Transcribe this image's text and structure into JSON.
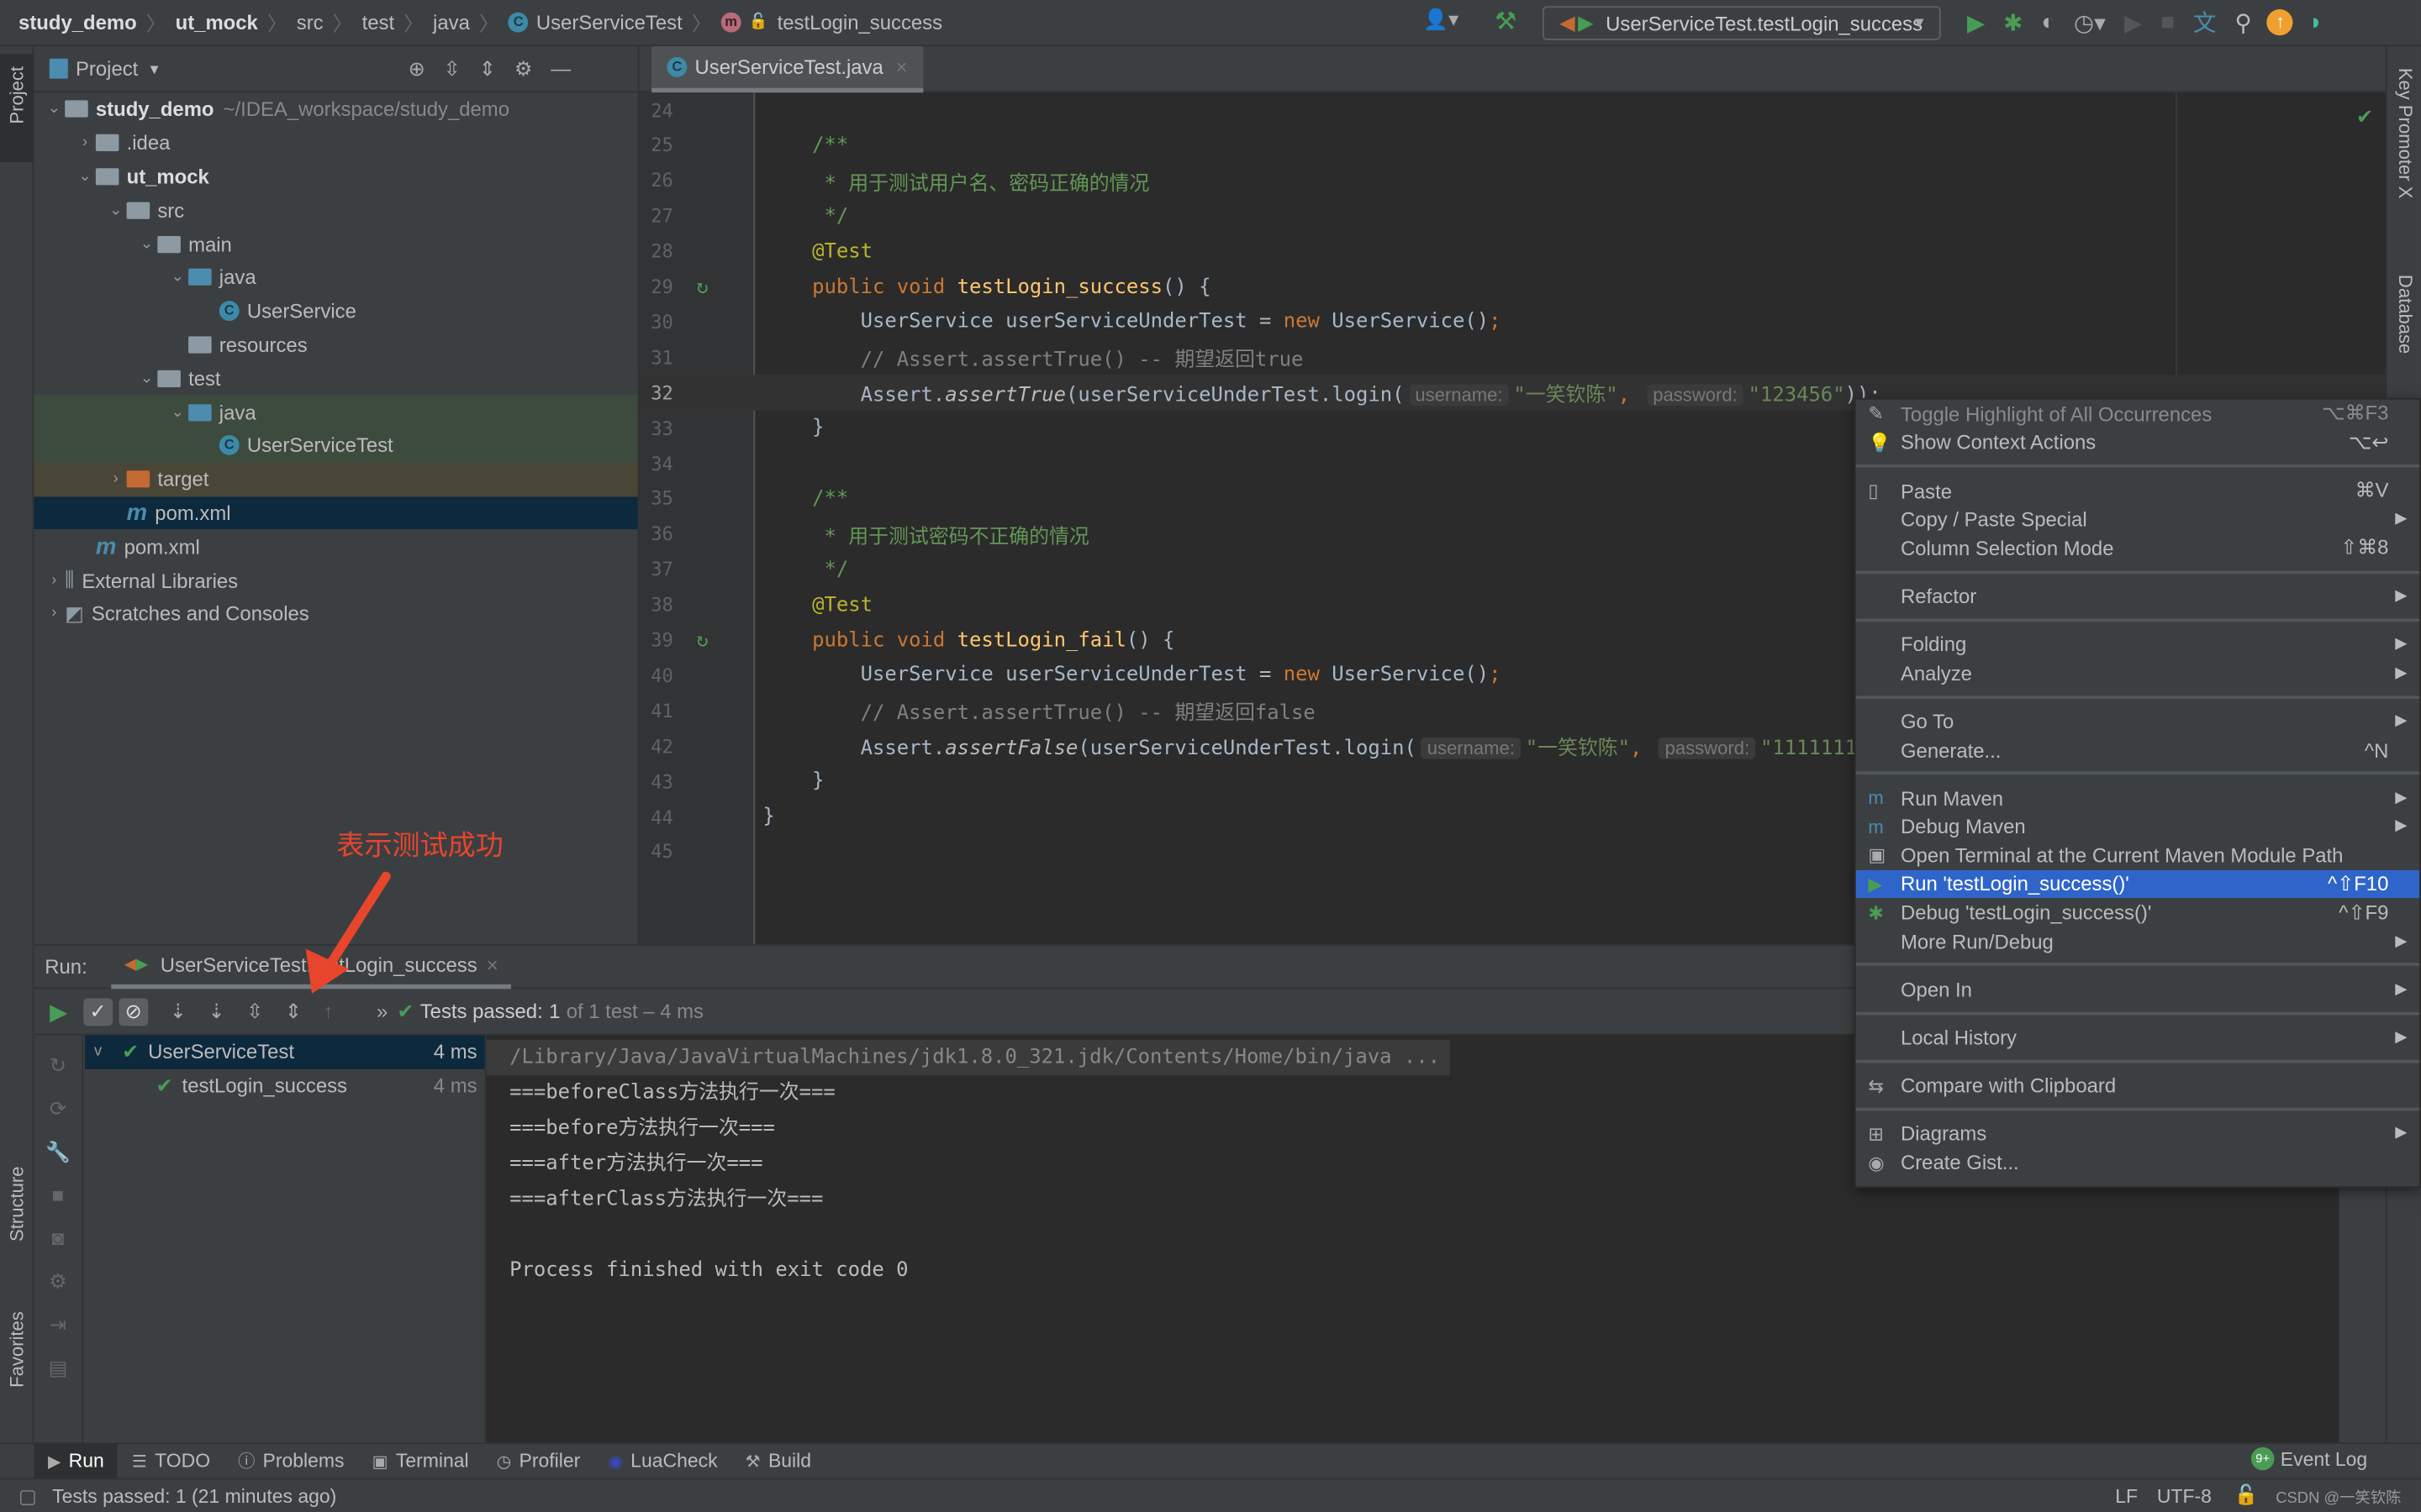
{
  "nav": {
    "breadcrumbs": [
      "study_demo",
      "ut_mock",
      "src",
      "test",
      "java",
      "UserServiceTest",
      "testLogin_success"
    ],
    "run_config": "UserServiceTest.testLogin_success"
  },
  "toolbar_icons": [
    "user-icon",
    "build-hammer-icon",
    "run-icon",
    "debug-icon",
    "coverage-icon",
    "profile-icon",
    "stop-icon",
    "translate-icon",
    "search-icon",
    "update-icon",
    "toolbox-icon"
  ],
  "left_strip": {
    "project": "Project",
    "structure": "Structure",
    "favorites": "Favorites"
  },
  "right_strip": {
    "key_promoter": "Key Promoter X",
    "database": "Database"
  },
  "project": {
    "title": "Project",
    "tree": [
      {
        "label": "study_demo",
        "extra": "~/IDEA_workspace/study_demo",
        "depth": 0,
        "arrow": "v",
        "icon": "folder",
        "bold": true
      },
      {
        "label": ".idea",
        "depth": 1,
        "arrow": ">",
        "icon": "folder"
      },
      {
        "label": "ut_mock",
        "depth": 1,
        "arrow": "v",
        "icon": "folder",
        "bold": true
      },
      {
        "label": "src",
        "depth": 2,
        "arrow": "v",
        "icon": "folder"
      },
      {
        "label": "main",
        "depth": 3,
        "arrow": "v",
        "icon": "folder"
      },
      {
        "label": "java",
        "depth": 4,
        "arrow": "v",
        "icon": "folder-blue"
      },
      {
        "label": "UserService",
        "depth": 5,
        "arrow": "",
        "icon": "class"
      },
      {
        "label": "resources",
        "depth": 4,
        "arrow": "",
        "icon": "folder"
      },
      {
        "label": "test",
        "depth": 3,
        "arrow": "v",
        "icon": "folder"
      },
      {
        "label": "java",
        "depth": 4,
        "arrow": "v",
        "icon": "folder-green",
        "hl": "green"
      },
      {
        "label": "UserServiceTest",
        "depth": 5,
        "arrow": "",
        "icon": "class",
        "hl": "green"
      },
      {
        "label": "target",
        "depth": 2,
        "arrow": ">",
        "icon": "folder-orange",
        "hl": "brown"
      },
      {
        "label": "pom.xml",
        "depth": 2,
        "arrow": "",
        "icon": "maven",
        "hl": "sel"
      },
      {
        "label": "pom.xml",
        "depth": 1,
        "arrow": "",
        "icon": "maven"
      },
      {
        "label": "External Libraries",
        "depth": 0,
        "arrow": ">",
        "icon": "library"
      },
      {
        "label": "Scratches and Consoles",
        "depth": 0,
        "arrow": ">",
        "icon": "scratch"
      }
    ]
  },
  "editor": {
    "tab": "UserServiceTest.java",
    "current_line": 32,
    "lines": [
      {
        "n": 24,
        "seg": []
      },
      {
        "n": 25,
        "seg": [
          [
            "d",
            "/**"
          ]
        ]
      },
      {
        "n": 26,
        "seg": [
          [
            "d",
            " * 用于测试用户名、密码正确的情况"
          ]
        ]
      },
      {
        "n": 27,
        "seg": [
          [
            "d",
            " */"
          ]
        ]
      },
      {
        "n": 28,
        "seg": [
          [
            "a",
            "@Test"
          ]
        ]
      },
      {
        "n": 29,
        "run": true,
        "seg": [
          [
            "k",
            "public void "
          ],
          [
            "f",
            "testLogin_success"
          ],
          [
            "t",
            "() {"
          ]
        ]
      },
      {
        "n": 30,
        "seg": [
          [
            "t",
            "    UserService userServiceUnderTest = "
          ],
          [
            "k",
            "new "
          ],
          [
            "t",
            "UserService()"
          ],
          [
            "k",
            ";"
          ]
        ]
      },
      {
        "n": 31,
        "seg": [
          [
            "c",
            "    // Assert.assertTrue() -- 期望返回true"
          ]
        ]
      },
      {
        "n": 32,
        "seg": [
          [
            "t",
            "    Assert."
          ],
          [
            "i",
            "assertTrue"
          ],
          [
            "t",
            "(userServiceUnderTest.login("
          ],
          [
            "h",
            "username:"
          ],
          [
            "s",
            "\"一笑钦陈\""
          ],
          [
            "k",
            ", "
          ],
          [
            "h",
            "password:"
          ],
          [
            "s",
            "\"123456\""
          ],
          [
            "t",
            "));"
          ]
        ]
      },
      {
        "n": 33,
        "seg": [
          [
            "t",
            "}"
          ]
        ]
      },
      {
        "n": 34,
        "seg": []
      },
      {
        "n": 35,
        "seg": [
          [
            "d",
            "/**"
          ]
        ]
      },
      {
        "n": 36,
        "seg": [
          [
            "d",
            " * 用于测试密码不正确的情况"
          ]
        ]
      },
      {
        "n": 37,
        "seg": [
          [
            "d",
            " */"
          ]
        ]
      },
      {
        "n": 38,
        "seg": [
          [
            "a",
            "@Test"
          ]
        ]
      },
      {
        "n": 39,
        "run": true,
        "seg": [
          [
            "k",
            "public void "
          ],
          [
            "f",
            "testLogin_fail"
          ],
          [
            "t",
            "() {"
          ]
        ]
      },
      {
        "n": 40,
        "seg": [
          [
            "t",
            "    UserService userServiceUnderTest = "
          ],
          [
            "k",
            "new "
          ],
          [
            "t",
            "UserService()"
          ],
          [
            "k",
            ";"
          ]
        ]
      },
      {
        "n": 41,
        "seg": [
          [
            "c",
            "    // Assert.assertTrue() -- 期望返回false"
          ]
        ]
      },
      {
        "n": 42,
        "seg": [
          [
            "t",
            "    Assert."
          ],
          [
            "i",
            "assertFalse"
          ],
          [
            "t",
            "(userServiceUnderTest.login("
          ],
          [
            "h",
            "username:"
          ],
          [
            "s",
            "\"一笑钦陈\""
          ],
          [
            "k",
            ", "
          ],
          [
            "h",
            "password:"
          ],
          [
            "s",
            "\"1111111"
          ]
        ]
      },
      {
        "n": 43,
        "seg": [
          [
            "t",
            "}"
          ]
        ]
      },
      {
        "n": 44,
        "outer": true,
        "seg": [
          [
            "t",
            "}"
          ]
        ]
      },
      {
        "n": 45,
        "seg": []
      }
    ]
  },
  "annotation": "表示测试成功",
  "run": {
    "label": "Run:",
    "tab": "UserServiceTest.testLogin_success",
    "status_prefix": "Tests passed:",
    "status_count": "1",
    "status_suffix": "of 1 test – 4 ms",
    "tree": [
      {
        "label": "UserServiceTest",
        "time": "4 ms"
      },
      {
        "label": "testLogin_success",
        "time": "4 ms"
      }
    ],
    "console": [
      "/Library/Java/JavaVirtualMachines/jdk1.8.0_321.jdk/Contents/Home/bin/java ...",
      "===beforeClass方法执行一次===",
      "===before方法执行一次===",
      "===after方法执行一次===",
      "===afterClass方法执行一次===",
      "",
      "Process finished with exit code 0"
    ]
  },
  "menu": {
    "groups": [
      [
        {
          "label": "Toggle Highlight of All Occurrences",
          "shortcut": "⌥⌘F3",
          "icon": "highlight-icon",
          "disabled": true
        },
        {
          "label": "Show Context Actions",
          "shortcut": "⌥↩",
          "icon": "bulb-icon"
        }
      ],
      [
        {
          "label": "Paste",
          "shortcut": "⌘V",
          "icon": "clipboard-icon"
        },
        {
          "label": "Copy / Paste Special",
          "sub": true
        },
        {
          "label": "Column Selection Mode",
          "shortcut": "⇧⌘8"
        }
      ],
      [
        {
          "label": "Refactor",
          "sub": true
        }
      ],
      [
        {
          "label": "Folding",
          "sub": true
        },
        {
          "label": "Analyze",
          "sub": true
        }
      ],
      [
        {
          "label": "Go To",
          "sub": true
        },
        {
          "label": "Generate...",
          "shortcut": "^N"
        }
      ],
      [
        {
          "label": "Run Maven",
          "sub": true,
          "icon": "maven-icon"
        },
        {
          "label": "Debug Maven",
          "sub": true,
          "icon": "maven-debug-icon"
        },
        {
          "label": "Open Terminal at the Current Maven Module Path",
          "icon": "terminal-icon"
        },
        {
          "label": "Run 'testLogin_success()'",
          "shortcut": "^⇧F10",
          "icon": "run-icon",
          "selected": true
        },
        {
          "label": "Debug 'testLogin_success()'",
          "shortcut": "^⇧F9",
          "icon": "debug-icon"
        },
        {
          "label": "More Run/Debug",
          "sub": true
        }
      ],
      [
        {
          "label": "Open In",
          "sub": true
        }
      ],
      [
        {
          "label": "Local History",
          "sub": true
        }
      ],
      [
        {
          "label": "Compare with Clipboard",
          "icon": "compare-icon"
        }
      ],
      [
        {
          "label": "Diagrams",
          "sub": true,
          "icon": "diagram-icon"
        },
        {
          "label": "Create Gist...",
          "icon": "github-icon"
        }
      ]
    ]
  },
  "bottom_tools": [
    "Run",
    "TODO",
    "Problems",
    "Terminal",
    "Profiler",
    "LuaCheck",
    "Build"
  ],
  "event_log": "Event Log",
  "status": {
    "message": "Tests passed: 1 (21 minutes ago)",
    "line_sep": "LF",
    "encoding": "UTF-8",
    "watermark": "CSDN @一笑钦陈"
  },
  "colors": {
    "accent": "#2f65ca",
    "success": "#499c54",
    "annotation": "#e8452d"
  }
}
